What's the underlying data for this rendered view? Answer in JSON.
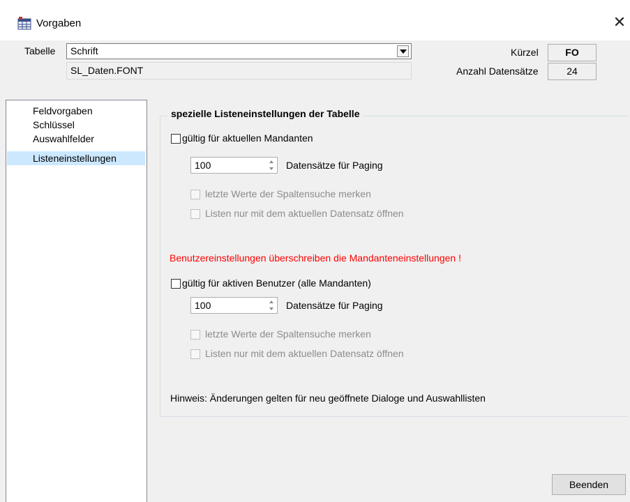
{
  "window": {
    "title": "Vorgaben",
    "close_icon": "close-icon",
    "app_icon": "grid-app-icon"
  },
  "header": {
    "tabelle_label": "Tabelle",
    "tabelle_value": "Schrift",
    "tabelle_path": "SL_Daten.FONT",
    "kuerzel_label": "Kürzel",
    "kuerzel_value": "FO",
    "anzahl_label": "Anzahl Datensätze",
    "anzahl_value": "24"
  },
  "sidebar": {
    "items": [
      {
        "label": "Feldvorgaben",
        "selected": false
      },
      {
        "label": "Schlüssel",
        "selected": false
      },
      {
        "label": "Auswahlfelder",
        "selected": false
      },
      {
        "label": "Listeneinstellungen",
        "selected": true
      }
    ]
  },
  "main": {
    "group_title": "spezielle Listeneinstellungen der Tabelle",
    "mandant": {
      "checkbox_label": "gültig für aktuellen Mandanten",
      "checked": false,
      "paging_value": "100",
      "paging_label": "Datensätze für Paging",
      "opt1_label": "letzte Werte der Spaltensuche merken",
      "opt2_label": "Listen nur mit dem aktuellen Datensatz öffnen"
    },
    "warning": "Benutzereinstellungen überschreiben die Mandanteneinstellungen !",
    "benutzer": {
      "checkbox_label": "gültig für aktiven Benutzer (alle Mandanten)",
      "checked": false,
      "paging_value": "100",
      "paging_label": "Datensätze für Paging",
      "opt1_label": "letzte Werte der Spaltensuche merken",
      "opt2_label": "Listen nur mit dem aktuellen Datensatz öffnen"
    },
    "hint": "Hinweis: Änderungen gelten für neu geöffnete Dialoge und Auswahllisten"
  },
  "footer": {
    "close_button": "Beenden"
  },
  "colors": {
    "warning": "#ff0000",
    "selection": "#cce8ff",
    "disabled_text": "#8c8c8c"
  }
}
